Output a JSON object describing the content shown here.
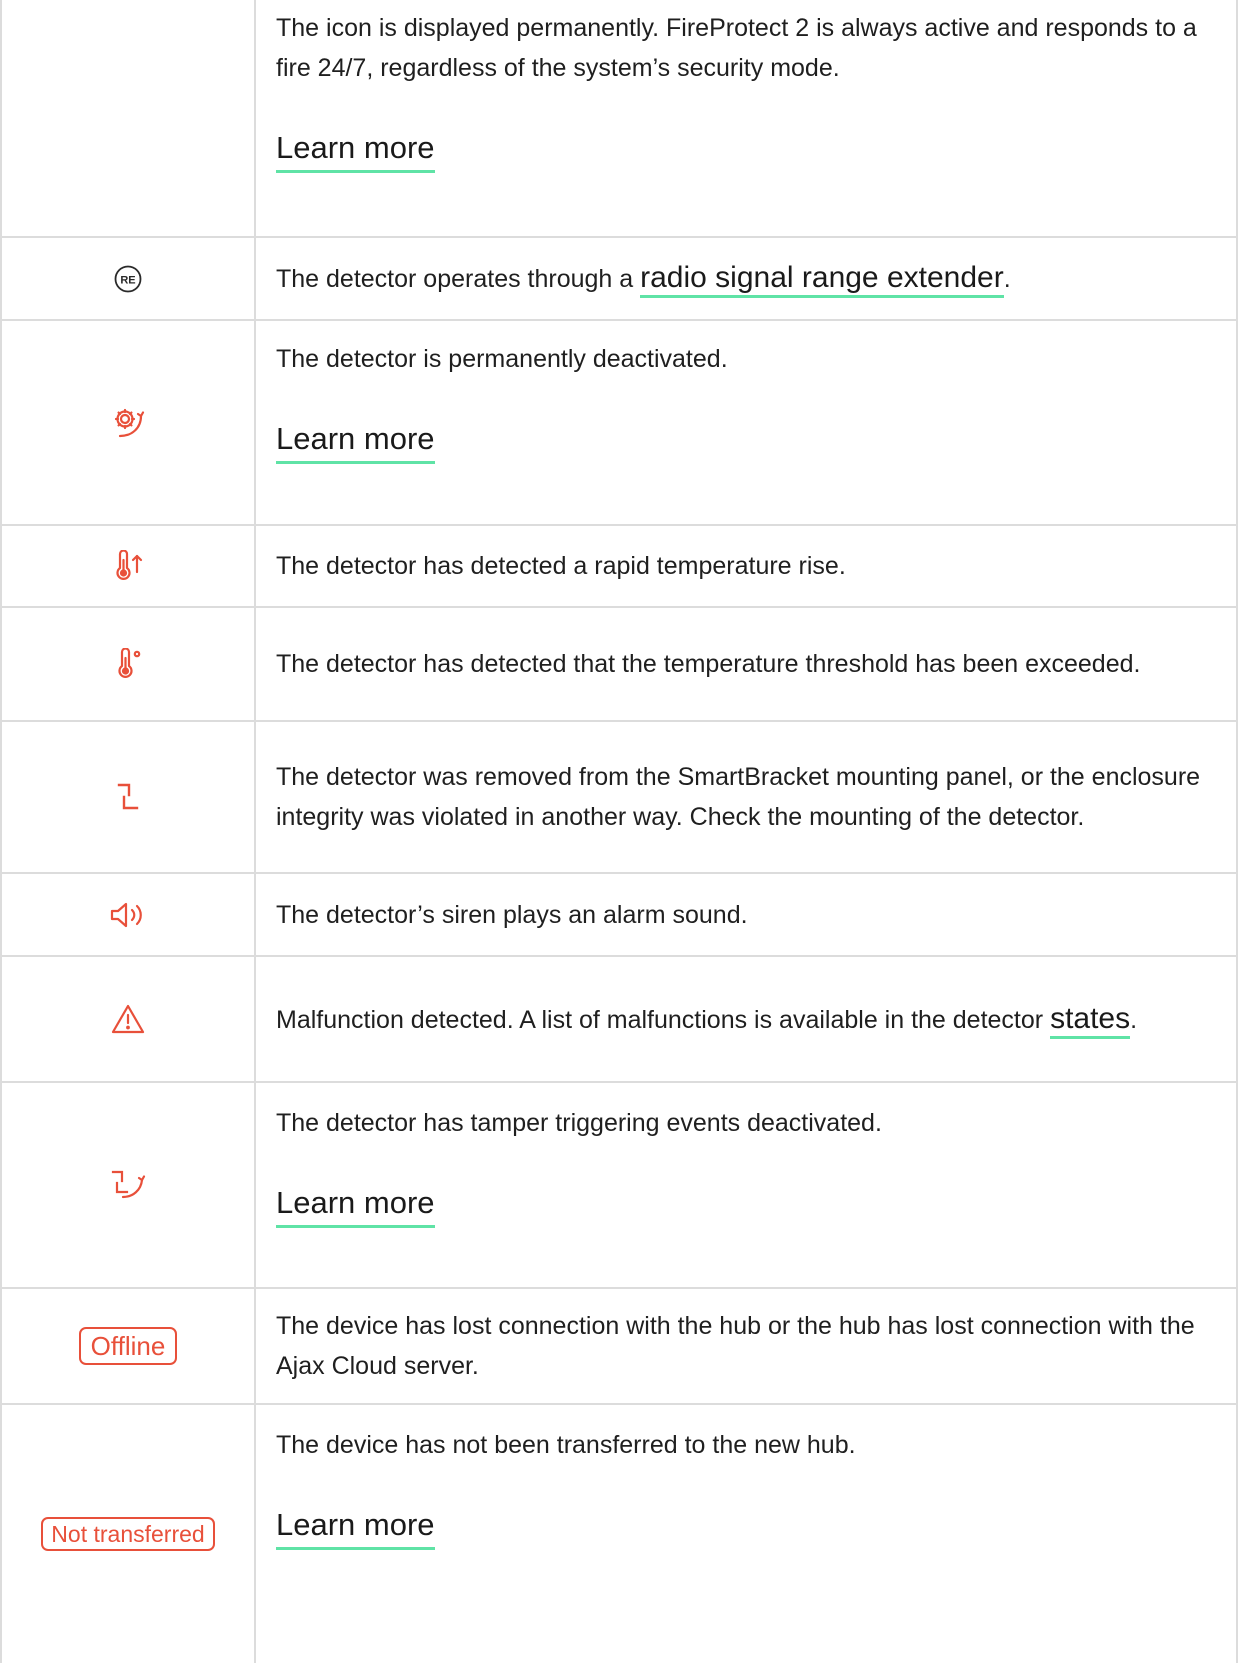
{
  "rows": [
    {
      "description": "The icon is displayed permanently. FireProtect 2 is always active and responds to a fire 24/7, regardless of the system’s security mode.",
      "link": "Learn more"
    },
    {
      "icon": "range-extender-icon",
      "description_prefix": "The detector operates through a ",
      "inline_link": "radio signal range extender",
      "description_suffix": "."
    },
    {
      "icon": "gear-deactivated-icon",
      "description": "The detector is permanently deactivated.",
      "link": "Learn more"
    },
    {
      "icon": "thermometer-rise-icon",
      "description": "The detector has detected a rapid temperature rise."
    },
    {
      "icon": "thermometer-threshold-icon",
      "description": "The detector has detected that the temperature threshold has been exceeded."
    },
    {
      "icon": "tamper-icon",
      "description": "The detector was removed from the SmartBracket mounting panel, or the enclosure integrity was violated in another way. Check the mounting of the detector."
    },
    {
      "icon": "siren-icon",
      "description": "The detector’s siren plays an alarm sound."
    },
    {
      "icon": "warning-icon",
      "description_prefix": "Malfunction detected. A list of malfunctions is available in the detector ",
      "inline_link": "states",
      "description_suffix": "."
    },
    {
      "icon": "tamper-deactivated-icon",
      "description": "The detector has tamper triggering events deactivated.",
      "link": "Learn more"
    },
    {
      "badge": "Offline",
      "description": "The device has lost connection with the hub or the hub has lost connection with the Ajax Cloud server."
    },
    {
      "badge": "Not transferred",
      "description": "The device has not been transferred to the new hub.",
      "link": "Learn more"
    }
  ],
  "colors": {
    "icon": "#e8503a",
    "link_underline": "#5fe3a6",
    "border": "#dcdcdc",
    "text": "#1f1f1f"
  }
}
